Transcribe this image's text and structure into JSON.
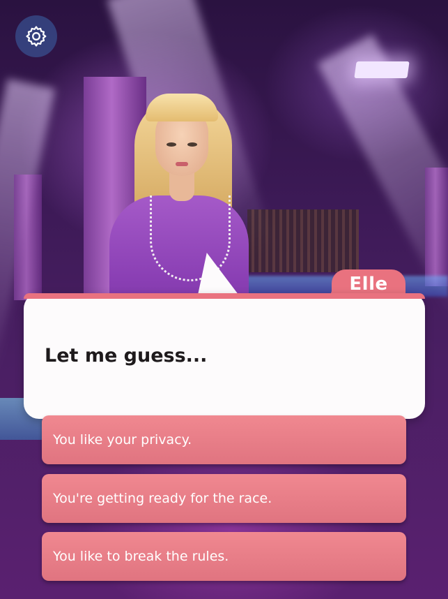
{
  "settings": {
    "icon": "gear-icon"
  },
  "dialog": {
    "speaker": "Elle",
    "text": "Let me guess..."
  },
  "choices": [
    {
      "label": "You like your privacy."
    },
    {
      "label": "You're getting ready for the race."
    },
    {
      "label": "You like to break the rules."
    }
  ],
  "colors": {
    "accent": "#e9727f",
    "choice_bg": "#ec7f88",
    "dialog_bg": "#fdfbfc",
    "text_dark": "#1e1a1c"
  }
}
